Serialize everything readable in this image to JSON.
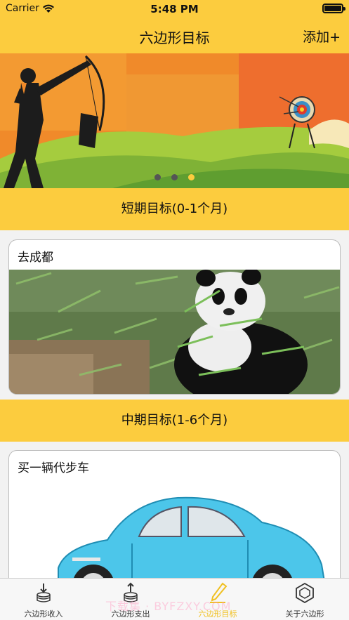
{
  "status_bar": {
    "carrier": "Carrier",
    "time": "5:48 PM"
  },
  "nav": {
    "title": "六边形目标",
    "add_label": "添加+"
  },
  "banner": {
    "dot_count": 3,
    "active_dot": 2
  },
  "sections": [
    {
      "title": "短期目标(0-1个月)",
      "goals": [
        {
          "name": "去成都",
          "image": "panda-photo"
        }
      ]
    },
    {
      "title": "中期目标(1-6个月)",
      "goals": [
        {
          "name": "买一辆代步车",
          "image": "blue-car-illustration"
        }
      ]
    }
  ],
  "tab_bar": {
    "items": [
      {
        "label": "六边形收入",
        "icon": "coin-stack-in-icon",
        "active": false
      },
      {
        "label": "六边形支出",
        "icon": "coin-stack-out-icon",
        "active": false
      },
      {
        "label": "六边形目标",
        "icon": "pencil-target-icon",
        "active": true
      },
      {
        "label": "关于六边形",
        "icon": "hexagon-icon",
        "active": false
      }
    ]
  },
  "colors": {
    "brand_yellow": "#fccc3e",
    "active_tab": "#f0c020"
  },
  "watermark": "下载集 · BYFZXY.COM"
}
